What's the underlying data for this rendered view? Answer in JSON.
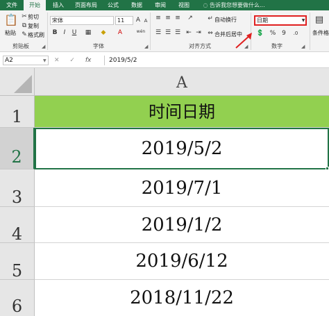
{
  "ribbon_tabs": [
    {
      "label": "文件",
      "active": false
    },
    {
      "label": "开始",
      "active": true
    },
    {
      "label": "插入",
      "active": false
    },
    {
      "label": "页面布局",
      "active": false
    },
    {
      "label": "公式",
      "active": false
    },
    {
      "label": "数据",
      "active": false
    },
    {
      "label": "审阅",
      "active": false
    },
    {
      "label": "视图",
      "active": false
    }
  ],
  "tell_me": "告诉我您想要做什么...",
  "clipboard": {
    "paste": "粘贴",
    "cut": "剪切",
    "copy": "复制",
    "format_painter": "格式刷",
    "group_label": "剪贴板"
  },
  "font": {
    "name": "宋体",
    "size": "11",
    "bold": "B",
    "italic": "I",
    "underline": "U",
    "grow": "A",
    "shrink": "A",
    "wen": "wén",
    "group_label": "字体"
  },
  "alignment": {
    "wrap_text": "自动换行",
    "merge_center": "合并后居中",
    "group_label": "对齐方式"
  },
  "number": {
    "format": "日期",
    "percent": "%",
    "comma": "9",
    "group_label": "数字"
  },
  "styles": {
    "conditional_format": "条件格式"
  },
  "formula_bar": {
    "name_box": "A2",
    "cancel": "✕",
    "confirm": "✓",
    "fx": "fx",
    "value": "2019/5/2"
  },
  "sheet": {
    "column_header": "A",
    "rows": [
      {
        "num": "1",
        "value": "时间日期"
      },
      {
        "num": "2",
        "value": "2019/5/2"
      },
      {
        "num": "3",
        "value": "2019/7/1"
      },
      {
        "num": "4",
        "value": "2019/1/2"
      },
      {
        "num": "5",
        "value": "2019/6/12"
      },
      {
        "num": "6",
        "value": "2018/11/22"
      }
    ]
  },
  "colors": {
    "brand_green": "#217346",
    "header_fill": "#92d050",
    "highlight_red": "#e02020"
  }
}
